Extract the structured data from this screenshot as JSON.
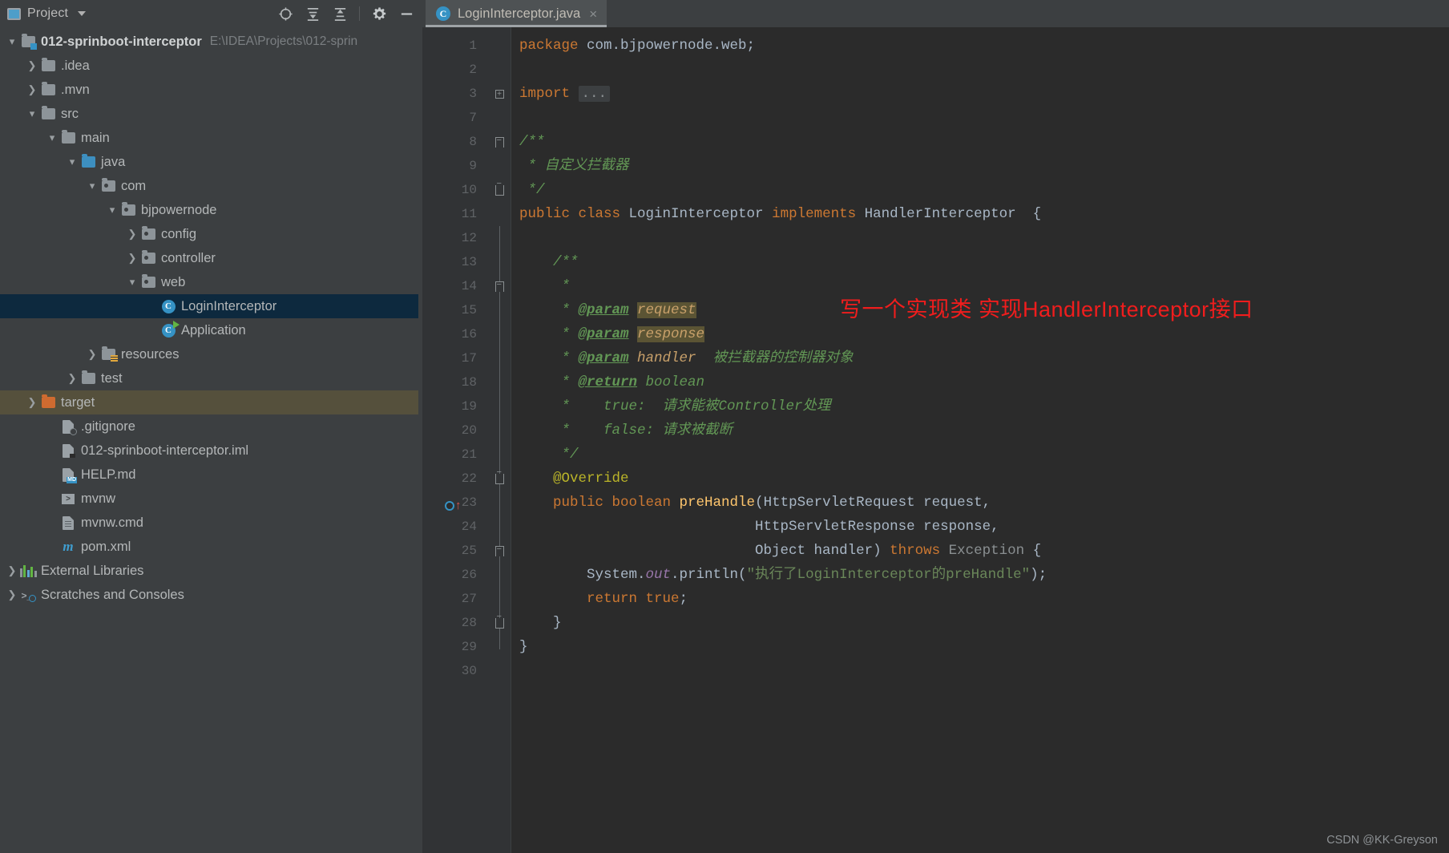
{
  "project_panel": {
    "title": "Project",
    "icons": [
      "project-window-icon",
      "chevron-down-icon",
      "locate-icon",
      "expand-all-icon",
      "collapse-all-icon",
      "gear-icon",
      "minimize-icon"
    ],
    "root": {
      "label": "012-sprinboot-interceptor",
      "path": "E:\\IDEA\\Projects\\012-sprin"
    },
    "tree": [
      {
        "label": ".idea",
        "depth": 1,
        "icon": "folder",
        "twisty": "collapsed"
      },
      {
        "label": ".mvn",
        "depth": 1,
        "icon": "folder",
        "twisty": "collapsed"
      },
      {
        "label": "src",
        "depth": 1,
        "icon": "folder",
        "twisty": "expanded"
      },
      {
        "label": "main",
        "depth": 2,
        "icon": "folder",
        "twisty": "expanded"
      },
      {
        "label": "java",
        "depth": 3,
        "icon": "folder-source",
        "twisty": "expanded"
      },
      {
        "label": "com",
        "depth": 4,
        "icon": "folder-package",
        "twisty": "expanded"
      },
      {
        "label": "bjpowernode",
        "depth": 5,
        "icon": "folder-package",
        "twisty": "expanded"
      },
      {
        "label": "config",
        "depth": 6,
        "icon": "folder-package",
        "twisty": "collapsed"
      },
      {
        "label": "controller",
        "depth": 6,
        "icon": "folder-package",
        "twisty": "collapsed"
      },
      {
        "label": "web",
        "depth": 6,
        "icon": "folder-package",
        "twisty": "expanded"
      },
      {
        "label": "LoginInterceptor",
        "depth": 7,
        "icon": "java-class",
        "twisty": "none",
        "selected": true
      },
      {
        "label": "Application",
        "depth": 7,
        "icon": "java-class-runnable",
        "twisty": "none"
      },
      {
        "label": "resources",
        "depth": 4,
        "icon": "folder-resources",
        "twisty": "collapsed"
      },
      {
        "label": "test",
        "depth": 3,
        "icon": "folder",
        "twisty": "collapsed"
      },
      {
        "label": "target",
        "depth": 1,
        "icon": "folder-excluded",
        "twisty": "collapsed",
        "highlight": true
      },
      {
        "label": ".gitignore",
        "depth": 2,
        "icon": "file-gitignore",
        "twisty": "none"
      },
      {
        "label": "012-sprinboot-interceptor.iml",
        "depth": 2,
        "icon": "file-iml",
        "twisty": "none"
      },
      {
        "label": "HELP.md",
        "depth": 2,
        "icon": "file-markdown",
        "twisty": "none"
      },
      {
        "label": "mvnw",
        "depth": 2,
        "icon": "file-shell",
        "twisty": "none"
      },
      {
        "label": "mvnw.cmd",
        "depth": 2,
        "icon": "file-cmd",
        "twisty": "none"
      },
      {
        "label": "pom.xml",
        "depth": 2,
        "icon": "file-maven",
        "twisty": "none"
      },
      {
        "label": "External Libraries",
        "depth": 0,
        "icon": "libraries",
        "twisty": "collapsed"
      },
      {
        "label": "Scratches and Consoles",
        "depth": 0,
        "icon": "scratches",
        "twisty": "collapsed"
      }
    ]
  },
  "editor": {
    "tab": {
      "label": "LoginInterceptor.java",
      "icon": "java-class-icon",
      "close": "×"
    },
    "line_numbers": [
      "1",
      "2",
      "3",
      "7",
      "8",
      "9",
      "10",
      "11",
      "12",
      "13",
      "14",
      "15",
      "16",
      "17",
      "18",
      "19",
      "20",
      "21",
      "22",
      "23",
      "24",
      "25",
      "26",
      "27",
      "28",
      "29",
      "30"
    ],
    "annotation": "写一个实现类 实现HandlerInterceptor接口",
    "code": {
      "l1_kw": "package",
      "l1_pkg": " com.bjpowernode.web;",
      "l3_kw": "import",
      "l3_fold": "...",
      "l8": "/**",
      "l9_star": " * ",
      "l9_txt": "自定义拦截器",
      "l10": " */",
      "l11_a": "public class ",
      "l11_b": "LoginInterceptor",
      "l11_c": " implements ",
      "l11_d": "HandlerInterceptor",
      "l11_e": "  {",
      "l13": "    /**",
      "l14": "     *",
      "l15_pre": "     * ",
      "l15_tag": "@param",
      "l15_name": "request",
      "l16_tag": "@param",
      "l16_name": "response",
      "l17_tag": "@param",
      "l17_name": "handler",
      "l17_desc": "  被拦截器的控制器对象",
      "l18_tag": "@return",
      "l18_desc": " boolean",
      "l19": "     *    true:  请求能被Controller处理",
      "l20": "     *    false: 请求被截断",
      "l21": "     */",
      "l22_ann": "@Override",
      "l23_kw": "    public boolean ",
      "l23_mth": "preHandle",
      "l23_a": "(HttpServletRequest request,",
      "l24": "                            HttpServletResponse response,",
      "l25_a": "                            Object handler) ",
      "l25_kw": "throws ",
      "l25_exc": "Exception",
      "l25_b": " {",
      "l26_a": "        System.",
      "l26_fld": "out",
      "l26_b": ".println(",
      "l26_str": "\"执行了LoginInterceptor的preHandle\"",
      "l26_c": ");",
      "l27_kw": "        return ",
      "l27_val": "true",
      "l27_end": ";",
      "l28": "    }",
      "l29": "}"
    }
  },
  "watermark": "CSDN @KK-Greyson",
  "colors": {
    "panel_bg": "#3c3f41",
    "editor_bg": "#2b2b2b",
    "gutter_bg": "#313335",
    "selection": "#0d293e",
    "target_highlight": "#55503c",
    "keyword": "#cc7832",
    "comment": "#629755",
    "string": "#6a8759",
    "annotation_yellow": "#bbb529",
    "method": "#ffc66d",
    "field_purple": "#9876aa",
    "accent_blue": "#3592c4",
    "annotation_red": "#f01d1d"
  }
}
